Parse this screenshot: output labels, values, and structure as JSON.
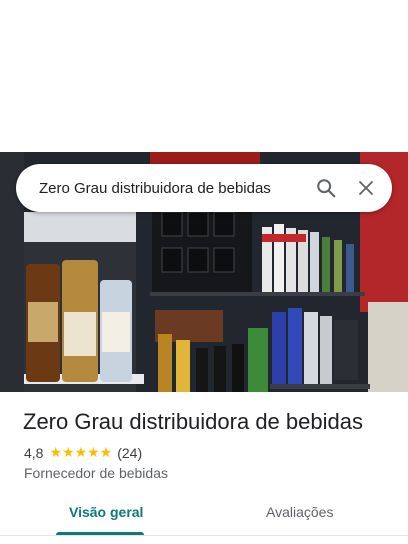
{
  "search": {
    "query": "Zero Grau distribuidora de bebidas"
  },
  "place": {
    "name": "Zero Grau distribuidora de bebidas",
    "rating": "4,8",
    "rating_value": 4.8,
    "stars": "★★★★★",
    "review_count": "(24)",
    "category": "Fornecedor de bebidas"
  },
  "tabs": [
    {
      "label": "Visão geral",
      "active": true
    },
    {
      "label": "Avaliações",
      "active": false
    }
  ],
  "colors": {
    "accent": "#0b7b79",
    "star": "#fbbc04"
  },
  "icons": {
    "search": "search-icon",
    "close": "close-icon"
  }
}
